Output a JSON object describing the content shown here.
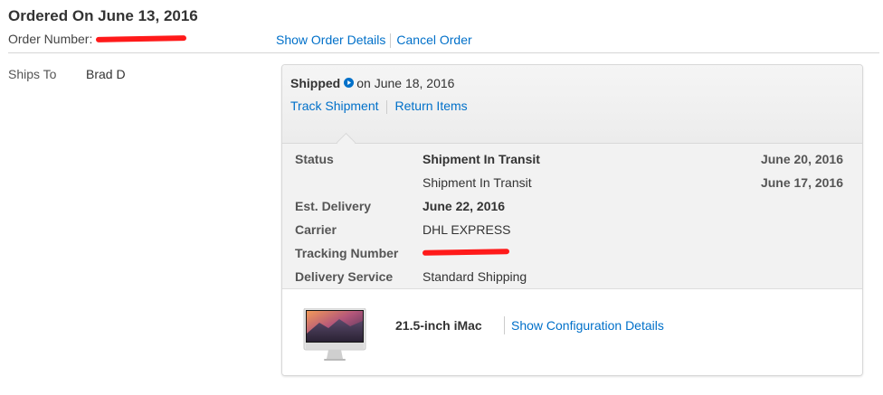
{
  "order": {
    "title": "Ordered On June 13, 2016",
    "number_label": "Order Number:",
    "links": {
      "show_details": "Show Order Details",
      "cancel": "Cancel Order"
    }
  },
  "ships_to": {
    "label": "Ships To",
    "name": "Brad D"
  },
  "shipment": {
    "status_word": "Shipped",
    "date_text": "on June 18, 2016",
    "links": {
      "track": "Track Shipment",
      "return": "Return Items"
    },
    "details": {
      "status_label": "Status",
      "status_rows": [
        {
          "text": "Shipment In Transit",
          "date": "June 20, 2016"
        },
        {
          "text": "Shipment In Transit",
          "date": "June 17, 2016"
        }
      ],
      "est_delivery_label": "Est. Delivery",
      "est_delivery_value": "June 22, 2016",
      "carrier_label": "Carrier",
      "carrier_value": "DHL EXPRESS",
      "tracking_label": "Tracking Number",
      "delivery_service_label": "Delivery Service",
      "delivery_service_value": "Standard Shipping"
    }
  },
  "product": {
    "name": "21.5-inch iMac",
    "config_link": "Show Configuration Details",
    "icon": "imac-image"
  },
  "colors": {
    "link": "#0070c9",
    "redaction": "#ff1a1a",
    "panel": "#f2f2f2"
  }
}
